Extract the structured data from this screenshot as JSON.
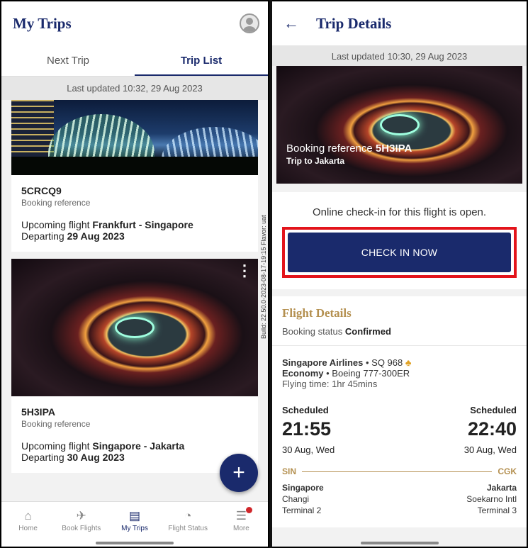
{
  "left": {
    "title": "My Trips",
    "tabs": [
      "Next Trip",
      "Trip List"
    ],
    "updated": "Last updated 10:32, 29 Aug 2023",
    "trips": [
      {
        "ref": "5CRCQ9",
        "ref_label": "Booking reference",
        "upcoming_prefix": "Upcoming flight ",
        "route": "Frankfurt - Singapore",
        "departing_prefix": "Departing ",
        "date": "29 Aug 2023"
      },
      {
        "ref": "5H3IPA",
        "ref_label": "Booking reference",
        "upcoming_prefix": "Upcoming flight ",
        "route": "Singapore - Jakarta",
        "departing_prefix": "Departing ",
        "date": "30 Aug 2023"
      }
    ],
    "build": "Build: 22.50.0-2023-08-17-19:15 Flavor: uat",
    "fab": "+",
    "nav": [
      "Home",
      "Book Flights",
      "My Trips",
      "Flight Status",
      "More"
    ]
  },
  "right": {
    "title": "Trip Details",
    "updated": "Last updated 10:30, 29 Aug 2023",
    "booking_prefix": "Booking reference ",
    "booking_ref": "5H3IPA",
    "trip_name": "Trip to Jakarta",
    "checkin_msg": "Online check-in for this flight is open.",
    "checkin_btn": "CHECK IN NOW",
    "fd_title": "Flight Details",
    "status_prefix": "Booking status ",
    "status": "Confirmed",
    "airline": "Singapore Airlines",
    "flight_no": " • SQ 968",
    "cabin": "Economy",
    "aircraft": " • Boeing 777-300ER",
    "flying_time": "Flying time: 1hr 45mins",
    "dep": {
      "label": "Scheduled",
      "time": "21:55",
      "date": "30 Aug, Wed",
      "code": "SIN",
      "city": "Singapore",
      "airport": "Changi",
      "terminal": "Terminal 2"
    },
    "arr": {
      "label": "Scheduled",
      "time": "22:40",
      "date": "30 Aug, Wed",
      "code": "CGK",
      "city": "Jakarta",
      "airport": "Soekarno Intl",
      "terminal": "Terminal 3"
    }
  },
  "colors": {
    "brand_navy": "#1a2a6c",
    "gold": "#b49050",
    "highlight": "#e3141b"
  }
}
